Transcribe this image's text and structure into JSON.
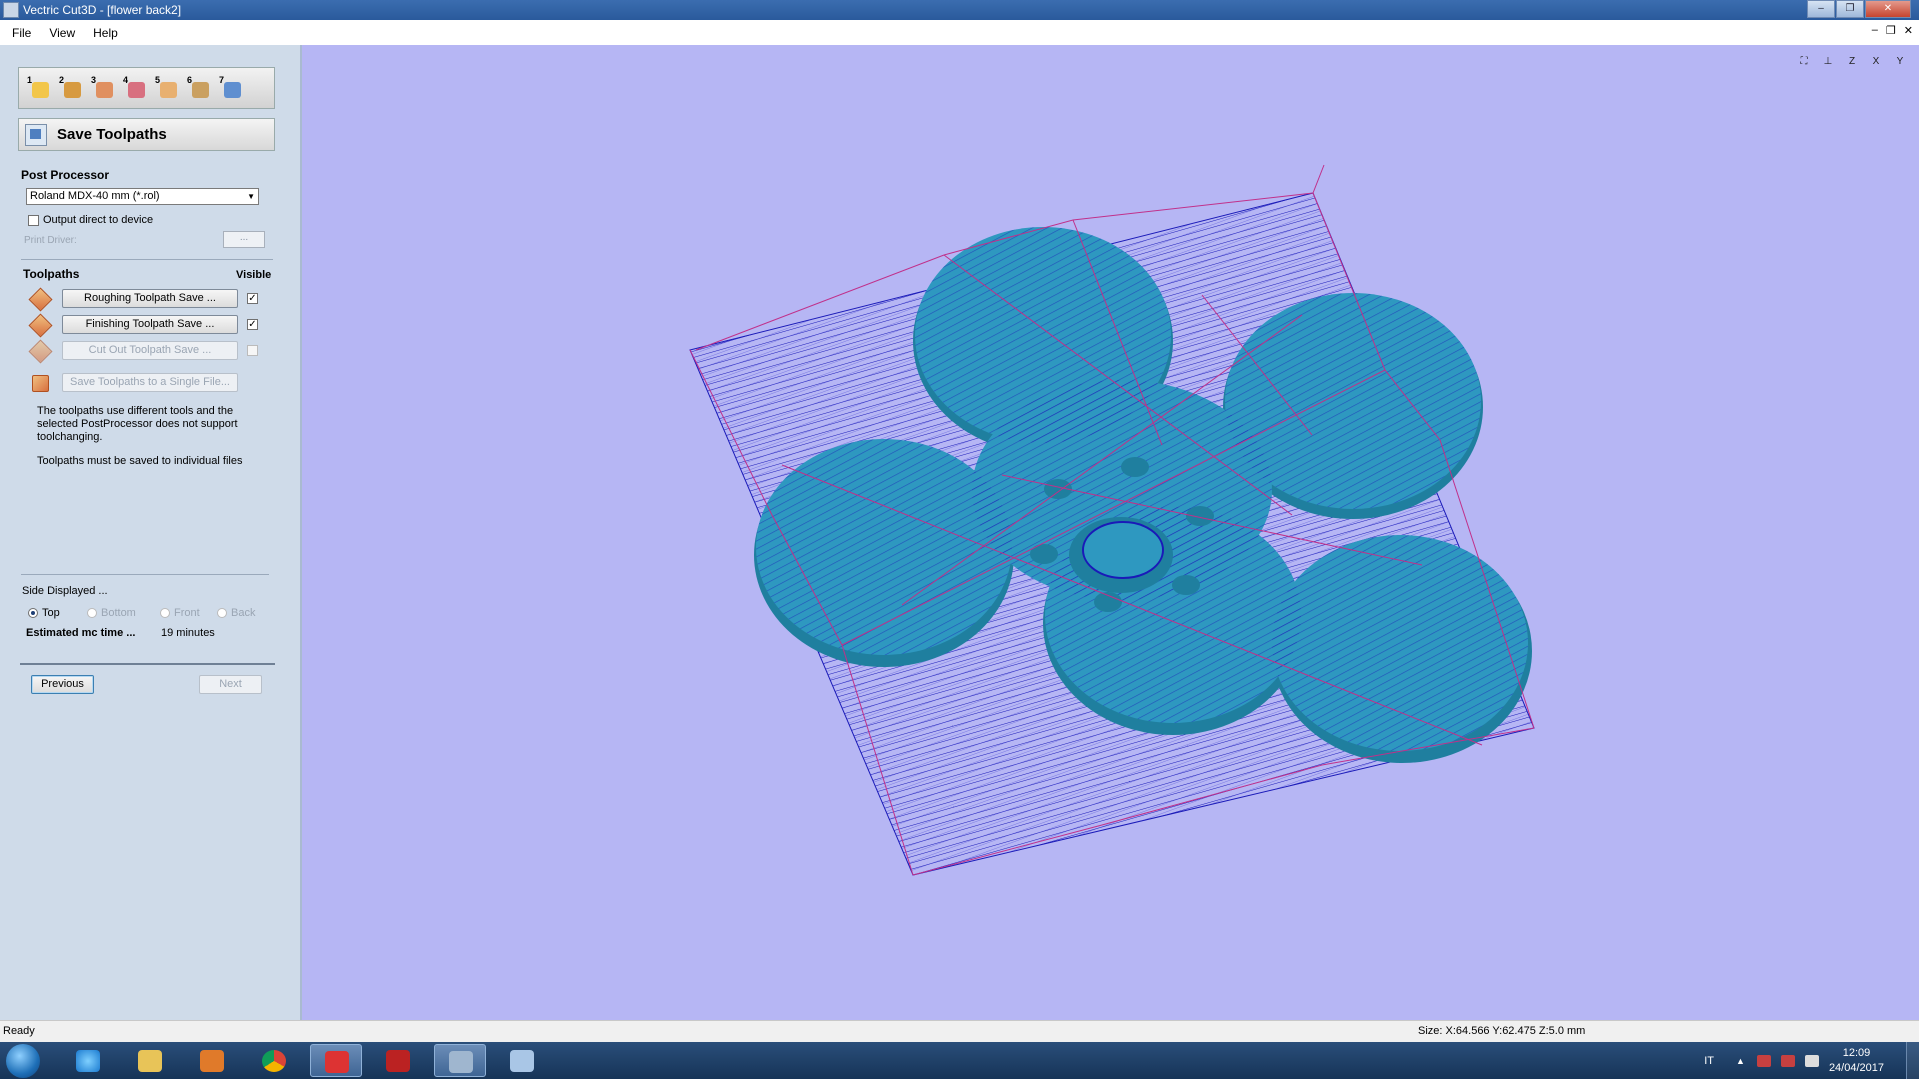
{
  "window": {
    "title": "Vectric Cut3D - [flower back2]"
  },
  "menu": {
    "file": "File",
    "view": "View",
    "help": "Help"
  },
  "wizard": {
    "steps": [
      "1",
      "2",
      "3",
      "4",
      "5",
      "6",
      "7"
    ],
    "header_title": "Save Toolpaths"
  },
  "post_processor": {
    "label": "Post Processor",
    "selected": "Roland MDX-40 mm (*.rol)",
    "output_direct_label": "Output direct to device",
    "output_direct_checked": false,
    "print_driver_label": "Print Driver:",
    "ellipsis": "..."
  },
  "toolpaths": {
    "label": "Toolpaths",
    "visible_label": "Visible",
    "items": [
      {
        "label": "Roughing Toolpath Save ...",
        "visible": "✓",
        "enabled": true
      },
      {
        "label": "Finishing Toolpath Save ...",
        "visible": "✓",
        "enabled": true
      },
      {
        "label": "Cut Out Toolpath Save ...",
        "visible": "",
        "enabled": false
      }
    ],
    "single_file_label": "Save Toolpaths to a Single File...",
    "note1": "The toolpaths use different tools and the selected PostProcessor does not support toolchanging.",
    "note2": "Toolpaths must be saved to individual files"
  },
  "side_displayed": {
    "label": "Side Displayed ...",
    "options": [
      "Top",
      "Bottom",
      "Front",
      "Back"
    ],
    "selected": "Top"
  },
  "estimate": {
    "label": "Estimated mc time ...",
    "value": "19 minutes"
  },
  "nav": {
    "previous": "Previous",
    "next": "Next"
  },
  "view_toolbar": [
    "zoom-fit",
    "iso",
    "Z",
    "X",
    "Y"
  ],
  "status": {
    "left": "Ready",
    "size": "Size: X:64.566 Y:62.475 Z:5.0 mm"
  },
  "taskbar": {
    "lang": "IT",
    "time": "12:09",
    "date": "24/04/2017"
  },
  "colors": {
    "viewport_bg": "#b6b6f4",
    "model_fill": "#2e98c0",
    "toolpath_blue": "#1a1ab8",
    "toolpath_magenta": "#c0308a"
  }
}
